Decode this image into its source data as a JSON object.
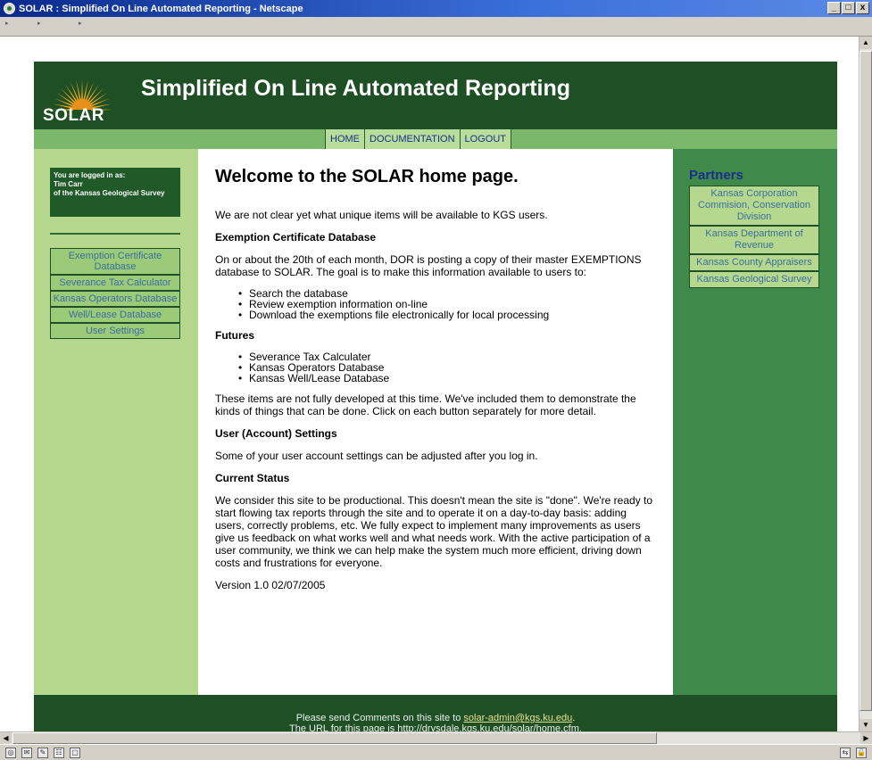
{
  "window": {
    "title": "SOLAR : Simplified On Line Automated Reporting - Netscape",
    "min_label": "_",
    "max_label": "□",
    "close_label": "x"
  },
  "header": {
    "logo_text": "SOLAR",
    "site_title": "Simplified On Line Automated Reporting",
    "logo_color": "#f4a81c"
  },
  "nav": {
    "items": [
      "HOME",
      "DOCUMENTATION",
      "LOGOUT"
    ]
  },
  "login": {
    "line1": "You are logged in as:",
    "line2": "Tim Carr",
    "line3": "of the Kansas Geological Survey"
  },
  "left_menu": {
    "items": [
      "Exemption Certificate Database",
      "Severance Tax Calculator",
      "Kansas Operators Database",
      "Well/Lease Database",
      "User Settings"
    ]
  },
  "main": {
    "heading": "Welcome to the SOLAR home page.",
    "intro": "We are not clear yet what unique items will be available to KGS users.",
    "exemption_heading": "Exemption Certificate Database",
    "exemption_text": "On or about the 20th of each month, DOR is posting a copy of their master EXEMPTIONS database to SOLAR. The goal is to make this information available to users to:",
    "exemption_items": [
      "Search the database",
      "Review exemption information on-line",
      "Download the exemptions file electronically for local processing"
    ],
    "futures_heading": "Futures",
    "futures_items": [
      "Severance Tax Calculater",
      "Kansas Operators Database",
      "Kansas Well/Lease Database"
    ],
    "futures_text": "These items are not fully developed at this time. We've included them to demonstrate the kinds of things that can be done. Click on each button separately for more detail.",
    "settings_heading": "User (Account) Settings",
    "settings_text": "Some of your user account settings can be adjusted after you log in.",
    "status_heading": "Current Status",
    "status_text": "We consider this site to be productional. This doesn't mean the site is \"done\". We're ready to start flowing tax reports through the site and to operate it on a day-to-day basis: adding users, correctly problems, etc. We fully expect to implement many improvements as users give us feedback on what works well and what needs work. With the active participation of a user community, we think we can help make the system much more efficient, driving down costs and frustrations for everyone.",
    "version": "Version 1.0 02/07/2005"
  },
  "partners": {
    "title": "Partners",
    "items": [
      "Kansas Corporation Commision, Conservation Division",
      "Kansas Department of Revenue",
      "Kansas County Appraisers",
      "Kansas Geological Survey"
    ]
  },
  "footer": {
    "comments_prefix": "Please send Comments on this site to ",
    "email": "solar-admin@kgs.ku.edu",
    "comments_suffix": ".",
    "url_line": "The URL for this page is http://drysdale.kgs.ku.edu/solar/home.cfm."
  }
}
